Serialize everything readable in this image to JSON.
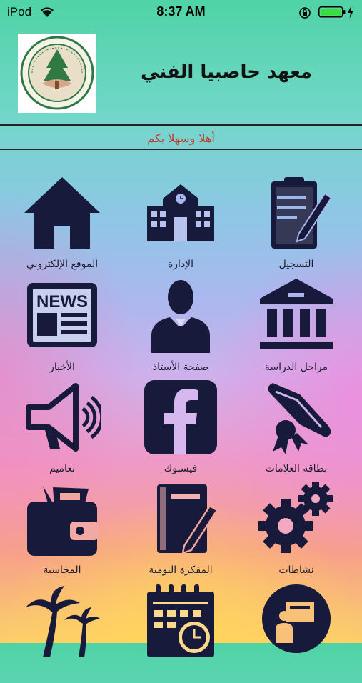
{
  "status_bar": {
    "carrier": "iPod",
    "time": "8:37 AM"
  },
  "header": {
    "title": "معهد حاصبيا الفني",
    "logo_alt": "HASBAYA TECHNICAL INSTITUTE"
  },
  "welcome": "أهلا وسهلا بكم",
  "menu": [
    {
      "label": "التسجيل",
      "icon": "registration-clipboard-icon"
    },
    {
      "label": "الإدارة",
      "icon": "administration-building-icon"
    },
    {
      "label": "الموقع الإلكتروني",
      "icon": "website-home-icon"
    },
    {
      "label": "مراحل الدراسة",
      "icon": "study-stages-institution-icon"
    },
    {
      "label": "صفحة الأستاذ",
      "icon": "teacher-page-person-icon"
    },
    {
      "label": "الأخبار",
      "icon": "news-icon"
    },
    {
      "label": "بطاقة العلامات",
      "icon": "grades-diploma-icon"
    },
    {
      "label": "فيسبوك",
      "icon": "facebook-icon"
    },
    {
      "label": "تعاميم",
      "icon": "announcements-megaphone-icon"
    },
    {
      "label": "نشاطات",
      "icon": "activities-gears-icon"
    },
    {
      "label": "المفكرة اليومية",
      "icon": "daily-notebook-pen-icon"
    },
    {
      "label": "المحاسبة",
      "icon": "accounting-wallet-icon"
    },
    {
      "label": "",
      "icon": "presentation-teacher-icon"
    },
    {
      "label": "",
      "icon": "calendar-clock-icon"
    },
    {
      "label": "",
      "icon": "palm-trees-icon"
    }
  ]
}
